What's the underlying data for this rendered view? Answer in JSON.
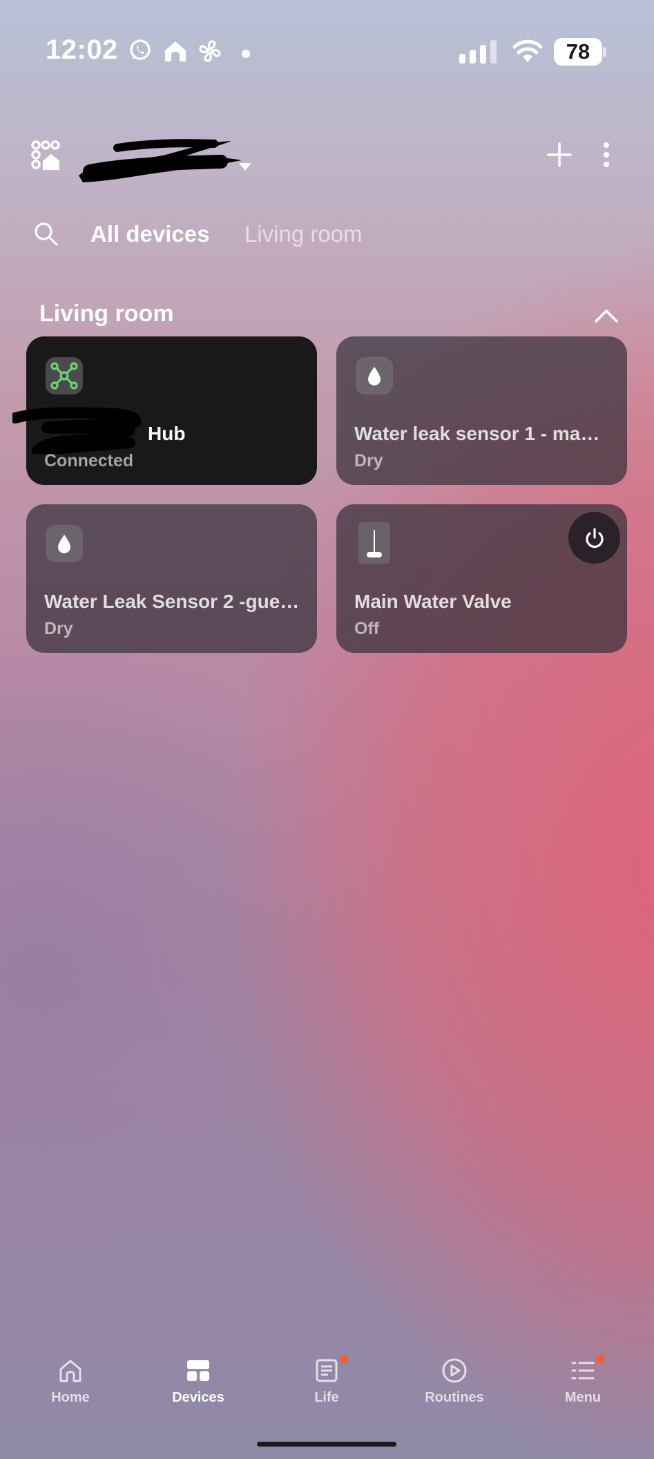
{
  "status_bar": {
    "time": "12:02",
    "battery_level": "78",
    "notification_icons": [
      "whatsapp-icon",
      "smart-home-icon",
      "fan-icon",
      "dot-icon"
    ],
    "signal_bars": 4
  },
  "header": {
    "home_name_redacted": true,
    "actions": [
      "add-icon",
      "more-vertical-icon"
    ]
  },
  "tabs": {
    "items": [
      {
        "label": "All devices",
        "active": true
      },
      {
        "label": "Living room",
        "active": false
      }
    ]
  },
  "section": {
    "title": "Living room",
    "expanded": true
  },
  "devices": [
    {
      "name": "Hub",
      "status": "Connected",
      "icon": "hub-icon",
      "icon_color": "#6fd36f",
      "style": "dark",
      "name_partially_redacted": true
    },
    {
      "name": "Water leak sensor 1 -  ma…",
      "status": "Dry",
      "icon": "water-drop-icon",
      "style": "glass"
    },
    {
      "name": "Water Leak Sensor 2 -gue…",
      "status": "Dry",
      "icon": "water-drop-icon",
      "style": "glass"
    },
    {
      "name": "Main Water Valve",
      "status": "Off",
      "icon": "valve-icon",
      "style": "glass",
      "has_power_button": true
    }
  ],
  "bottom_nav": {
    "items": [
      {
        "label": "Home",
        "icon": "home-icon",
        "active": false,
        "badge": false
      },
      {
        "label": "Devices",
        "icon": "devices-icon",
        "active": true,
        "badge": false
      },
      {
        "label": "Life",
        "icon": "life-icon",
        "active": false,
        "badge": true
      },
      {
        "label": "Routines",
        "icon": "routines-icon",
        "active": false,
        "badge": false
      },
      {
        "label": "Menu",
        "icon": "menu-icon",
        "active": false,
        "badge": true
      }
    ],
    "badge_color": "#ff5a1e"
  }
}
